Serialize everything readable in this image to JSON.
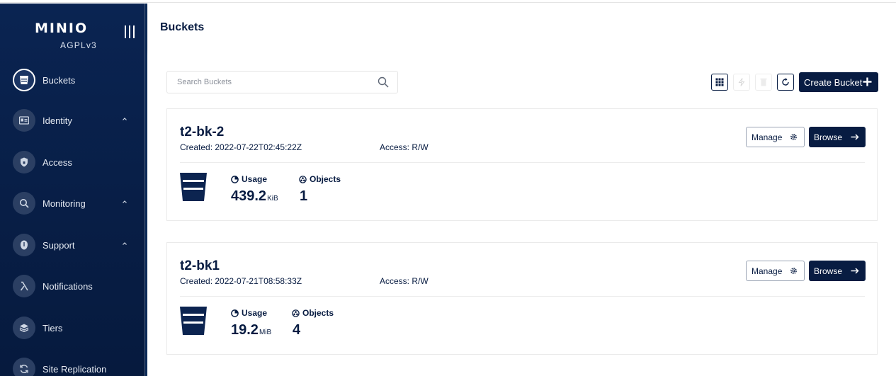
{
  "sidebar": {
    "logo": "MINIO",
    "license": "AGPLv3",
    "items": [
      {
        "label": "Buckets",
        "icon": "bucket-icon",
        "caret": false,
        "active": true
      },
      {
        "label": "Identity",
        "icon": "id-card-icon",
        "caret": true
      },
      {
        "label": "Access",
        "icon": "shield-icon",
        "caret": false
      },
      {
        "label": "Monitoring",
        "icon": "magnifier-icon",
        "caret": true
      },
      {
        "label": "Support",
        "icon": "support-icon",
        "caret": true
      },
      {
        "label": "Notifications",
        "icon": "lambda-icon",
        "caret": false
      },
      {
        "label": "Tiers",
        "icon": "layers-icon",
        "caret": false
      },
      {
        "label": "Site Replication",
        "icon": "sync-icon",
        "caret": false
      }
    ]
  },
  "header": {
    "title": "Buckets"
  },
  "search": {
    "placeholder": "Search Buckets",
    "value": ""
  },
  "toolbar": {
    "create_label": "Create Bucket"
  },
  "buckets": [
    {
      "name": "t2-bk-2",
      "created": "Created: 2022-07-22T02:45:22Z",
      "access": "Access: R/W",
      "manage_label": "Manage",
      "browse_label": "Browse",
      "usage_label": "Usage",
      "usage_value": "439.2",
      "usage_unit": "KiB",
      "objects_label": "Objects",
      "objects_value": "1"
    },
    {
      "name": "t2-bk1",
      "created": "Created: 2022-07-21T08:58:33Z",
      "access": "Access: R/W",
      "manage_label": "Manage",
      "browse_label": "Browse",
      "usage_label": "Usage",
      "usage_value": "19.2",
      "usage_unit": "MiB",
      "objects_label": "Objects",
      "objects_value": "4"
    }
  ],
  "colors": {
    "sidebar_bg": "#081e46",
    "primary": "#081c42",
    "text_on_dark": "#e6ebf3"
  }
}
